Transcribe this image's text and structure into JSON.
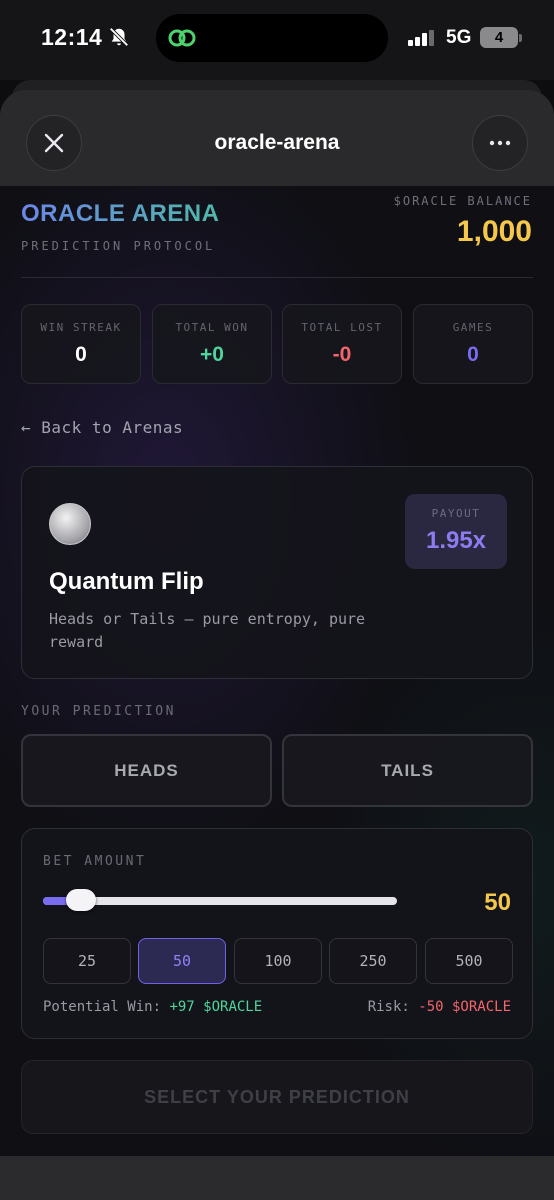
{
  "status_bar": {
    "time": "12:14",
    "network": "5G",
    "battery": "4"
  },
  "header": {
    "title": "oracle-arena"
  },
  "brand": {
    "name": "ORACLE ARENA",
    "subtitle": "PREDICTION PROTOCOL"
  },
  "balance": {
    "label": "$ORACLE BALANCE",
    "value": "1,000"
  },
  "stats": [
    {
      "label": "WIN STREAK",
      "value": "0",
      "color": "#ffffff"
    },
    {
      "label": "TOTAL WON",
      "value": "+0",
      "color": "#4fd49a"
    },
    {
      "label": "TOTAL LOST",
      "value": "-0",
      "color": "#f2656a"
    },
    {
      "label": "GAMES",
      "value": "0",
      "color": "#7a6cf0"
    }
  ],
  "back_link": "← Back to Arenas",
  "game": {
    "title": "Quantum Flip",
    "description": "Heads or Tails — pure entropy, pure reward",
    "payout_label": "PAYOUT",
    "payout_value": "1.95x",
    "icon": "coin-icon"
  },
  "prediction": {
    "label": "YOUR PREDICTION",
    "options": [
      "HEADS",
      "TAILS"
    ]
  },
  "bet": {
    "label": "BET AMOUNT",
    "value": "50",
    "slider_fraction": 0.04,
    "chips": [
      "25",
      "50",
      "100",
      "250",
      "500"
    ],
    "selected_chip": "50",
    "potential_win_label": "Potential Win:",
    "potential_win_value": "+97 $ORACLE",
    "risk_label": "Risk:",
    "risk_value": "-50 $ORACLE"
  },
  "cta_label": "SELECT YOUR PREDICTION",
  "colors": {
    "accent": "#7a6cf0",
    "gold": "#f5c84c",
    "green": "#4fd49a",
    "red": "#f2656a"
  }
}
